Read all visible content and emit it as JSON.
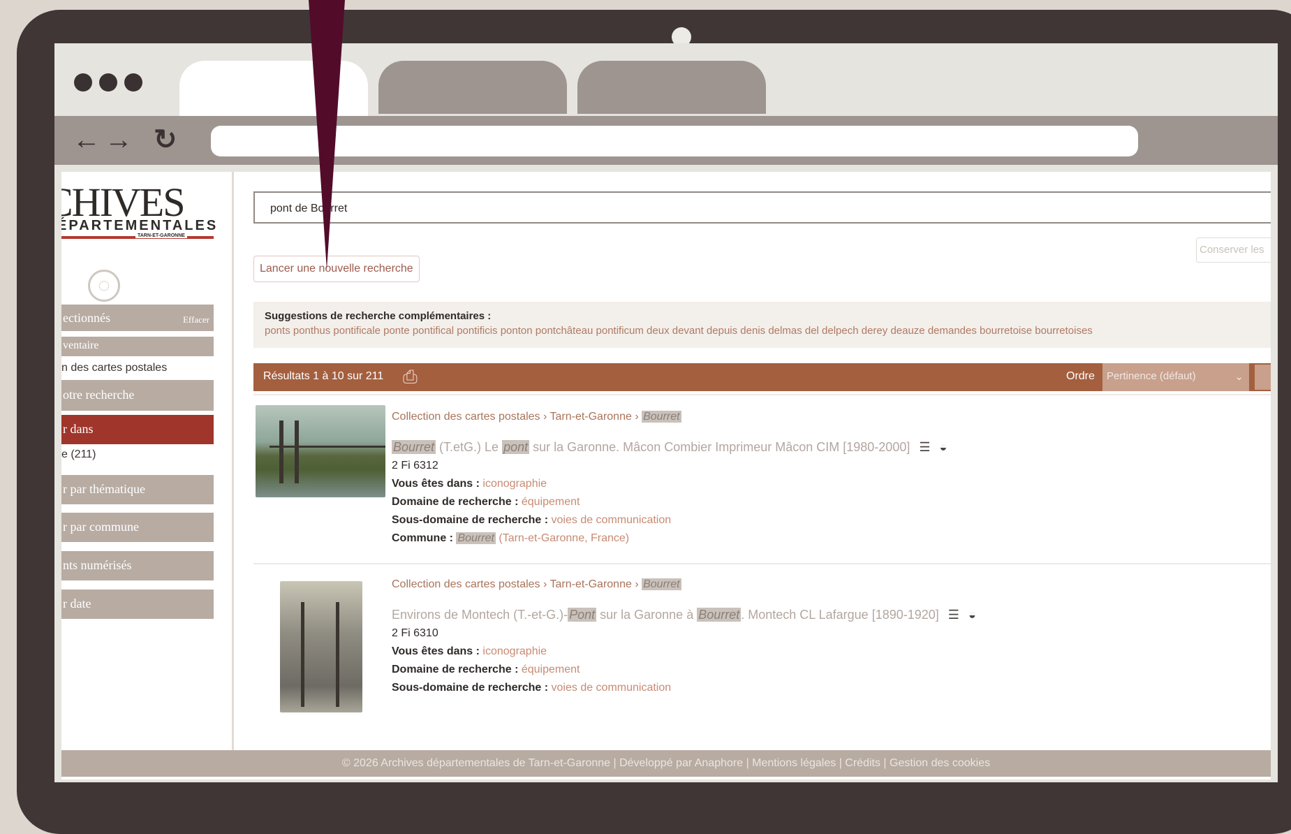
{
  "site": {
    "logo_main": "CHIVES",
    "logo_sub": "ÉPARTEMENTALES",
    "logo_tiny": "TARN-ET-GARONNE"
  },
  "sidebar": {
    "selected_label": "ectionnés",
    "erase_label": "Effacer",
    "inventory_label": "ventaire",
    "collection_text": "n des cartes postales",
    "refine_label": "otre recherche",
    "search_in_label": "r dans",
    "count_text": "e (211)",
    "by_theme_label": "r par thématique",
    "by_commune_label": "r par commune",
    "digitized_label": "nts numérisés",
    "by_date_label": "r date"
  },
  "search": {
    "query": "pont de Bourret",
    "keep_label": "Conserver les",
    "new_search_label": "Lancer une nouvelle recherche"
  },
  "suggestions": {
    "title": "Suggestions de recherche complémentaires :",
    "words": "ponts ponthus pontificale ponte pontifical pontificis ponton pontchâteau pontificum deux devant depuis denis delmas del delpech derey deauze demandes bourretoise bourretoises"
  },
  "results_bar": {
    "count": "Résultats 1 à 10 sur 211",
    "order_label": "Ordre",
    "order_value": "Pertinence (défaut)"
  },
  "results": [
    {
      "crumb_prefix": "Collection des cartes postales › Tarn-et-Garonne ›",
      "crumb_hl": "Bourret",
      "title_hl1": "Bourret",
      "title_mid": " (T.etG.) Le ",
      "title_hl2": "pont",
      "title_end": " sur la Garonne. Mâcon Combier Imprimeur Mâcon CIM [1980-2000]",
      "ref": "2 Fi 6312",
      "vous_label": "Vous êtes dans :",
      "vous_value": "iconographie",
      "domaine_label": "Domaine de recherche :",
      "domaine_value": "équipement",
      "sousdomaine_label": "Sous-domaine de recherche :",
      "sousdomaine_value": "voies de communication",
      "commune_label": "Commune :",
      "commune_hl": "Bourret",
      "commune_rest": " (Tarn-et-Garonne, France)"
    },
    {
      "crumb_prefix": "Collection des cartes postales › Tarn-et-Garonne ›",
      "crumb_hl": "Bourret",
      "title_start": "Environs de Montech (T.-et-G.)-",
      "title_hl1": "Pont",
      "title_mid": " sur la Garonne à ",
      "title_hl2": "Bourret",
      "title_end": ". Montech CL Lafargue [1890-1920]",
      "ref": "2 Fi 6310",
      "vous_label": "Vous êtes dans :",
      "vous_value": "iconographie",
      "domaine_label": "Domaine de recherche :",
      "domaine_value": "équipement",
      "sousdomaine_label": "Sous-domaine de recherche :",
      "sousdomaine_value": "voies de communication"
    }
  ],
  "footer": {
    "text": "© 2026 Archives départementales de Tarn-et-Garonne | Développé par Anaphore | Mentions légales | Crédits | Gestion des cookies"
  },
  "icons": {
    "back": "arrow-left",
    "forward": "arrow-right",
    "reload": "reload",
    "print": "printer",
    "globe": "globe",
    "basket": "basket",
    "list": "document-list"
  },
  "colors": {
    "device": "#403636",
    "accent_brown": "#a45f3f",
    "sidebar_block": "#b7aba2",
    "sidebar_active": "#a0352b",
    "pointer": "#520c2a"
  }
}
